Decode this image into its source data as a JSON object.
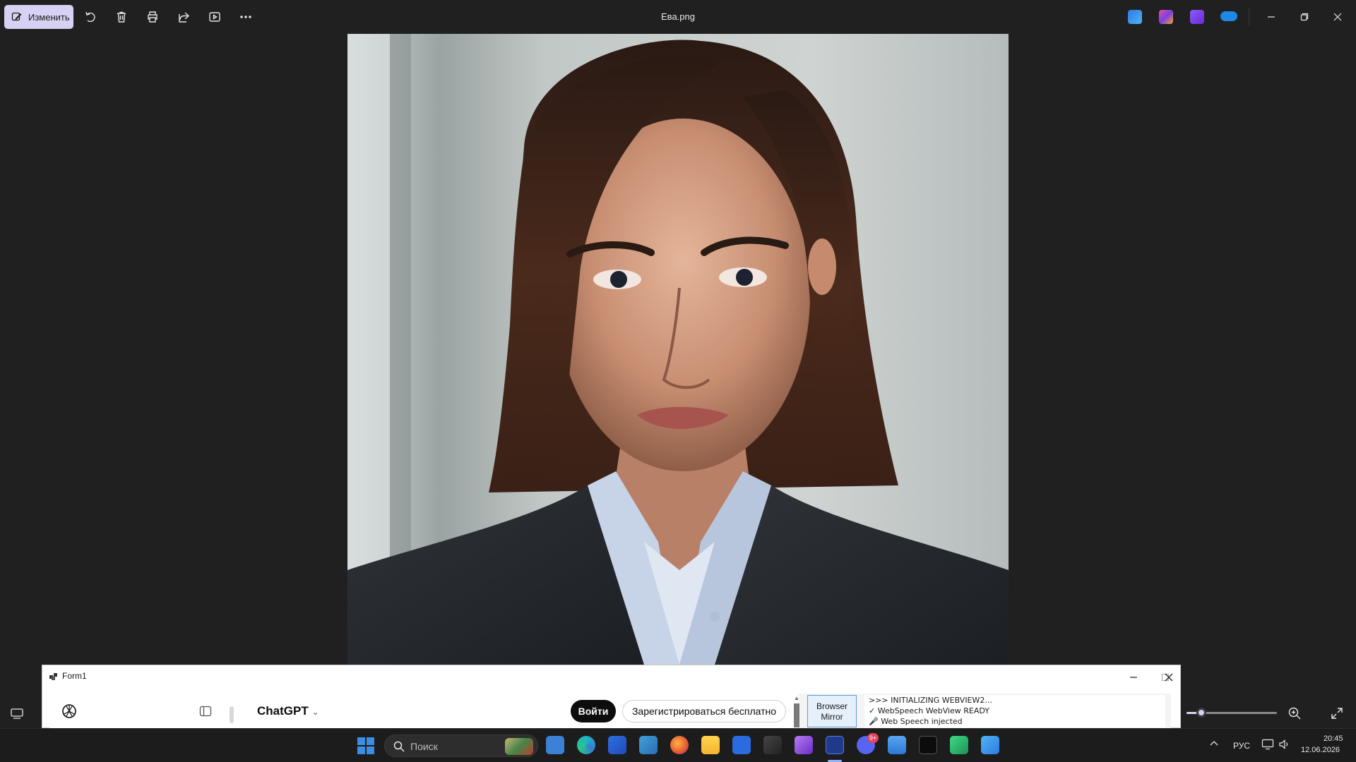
{
  "window": {
    "file_title": "Ева.png"
  },
  "toolbar": {
    "edit_label": "Изменить"
  },
  "form1": {
    "title": "Form1",
    "chatgpt": {
      "model_label": "ChatGPT",
      "login_label": "Войти",
      "signup_label": "Зарегистрироваться бесплатно"
    },
    "browser_mirror": [
      "Browser",
      "Mirror"
    ],
    "log_lines": [
      ">>> INITIALIZING WEBVIEW2...",
      "✓ WebSpeech WebView READY",
      "🎤 Web Speech injected"
    ]
  },
  "taskbar": {
    "search_placeholder": "Поиск",
    "discord_badge": "9+",
    "language": "РУС",
    "time": "20:45",
    "date": "12.06.2026"
  },
  "colors": {
    "edit_button_bg": "#d7d2f3",
    "photos_bg": "#202020",
    "taskbar_bg": "#1c1c1c",
    "windows_blue": "#3b8fe0"
  }
}
